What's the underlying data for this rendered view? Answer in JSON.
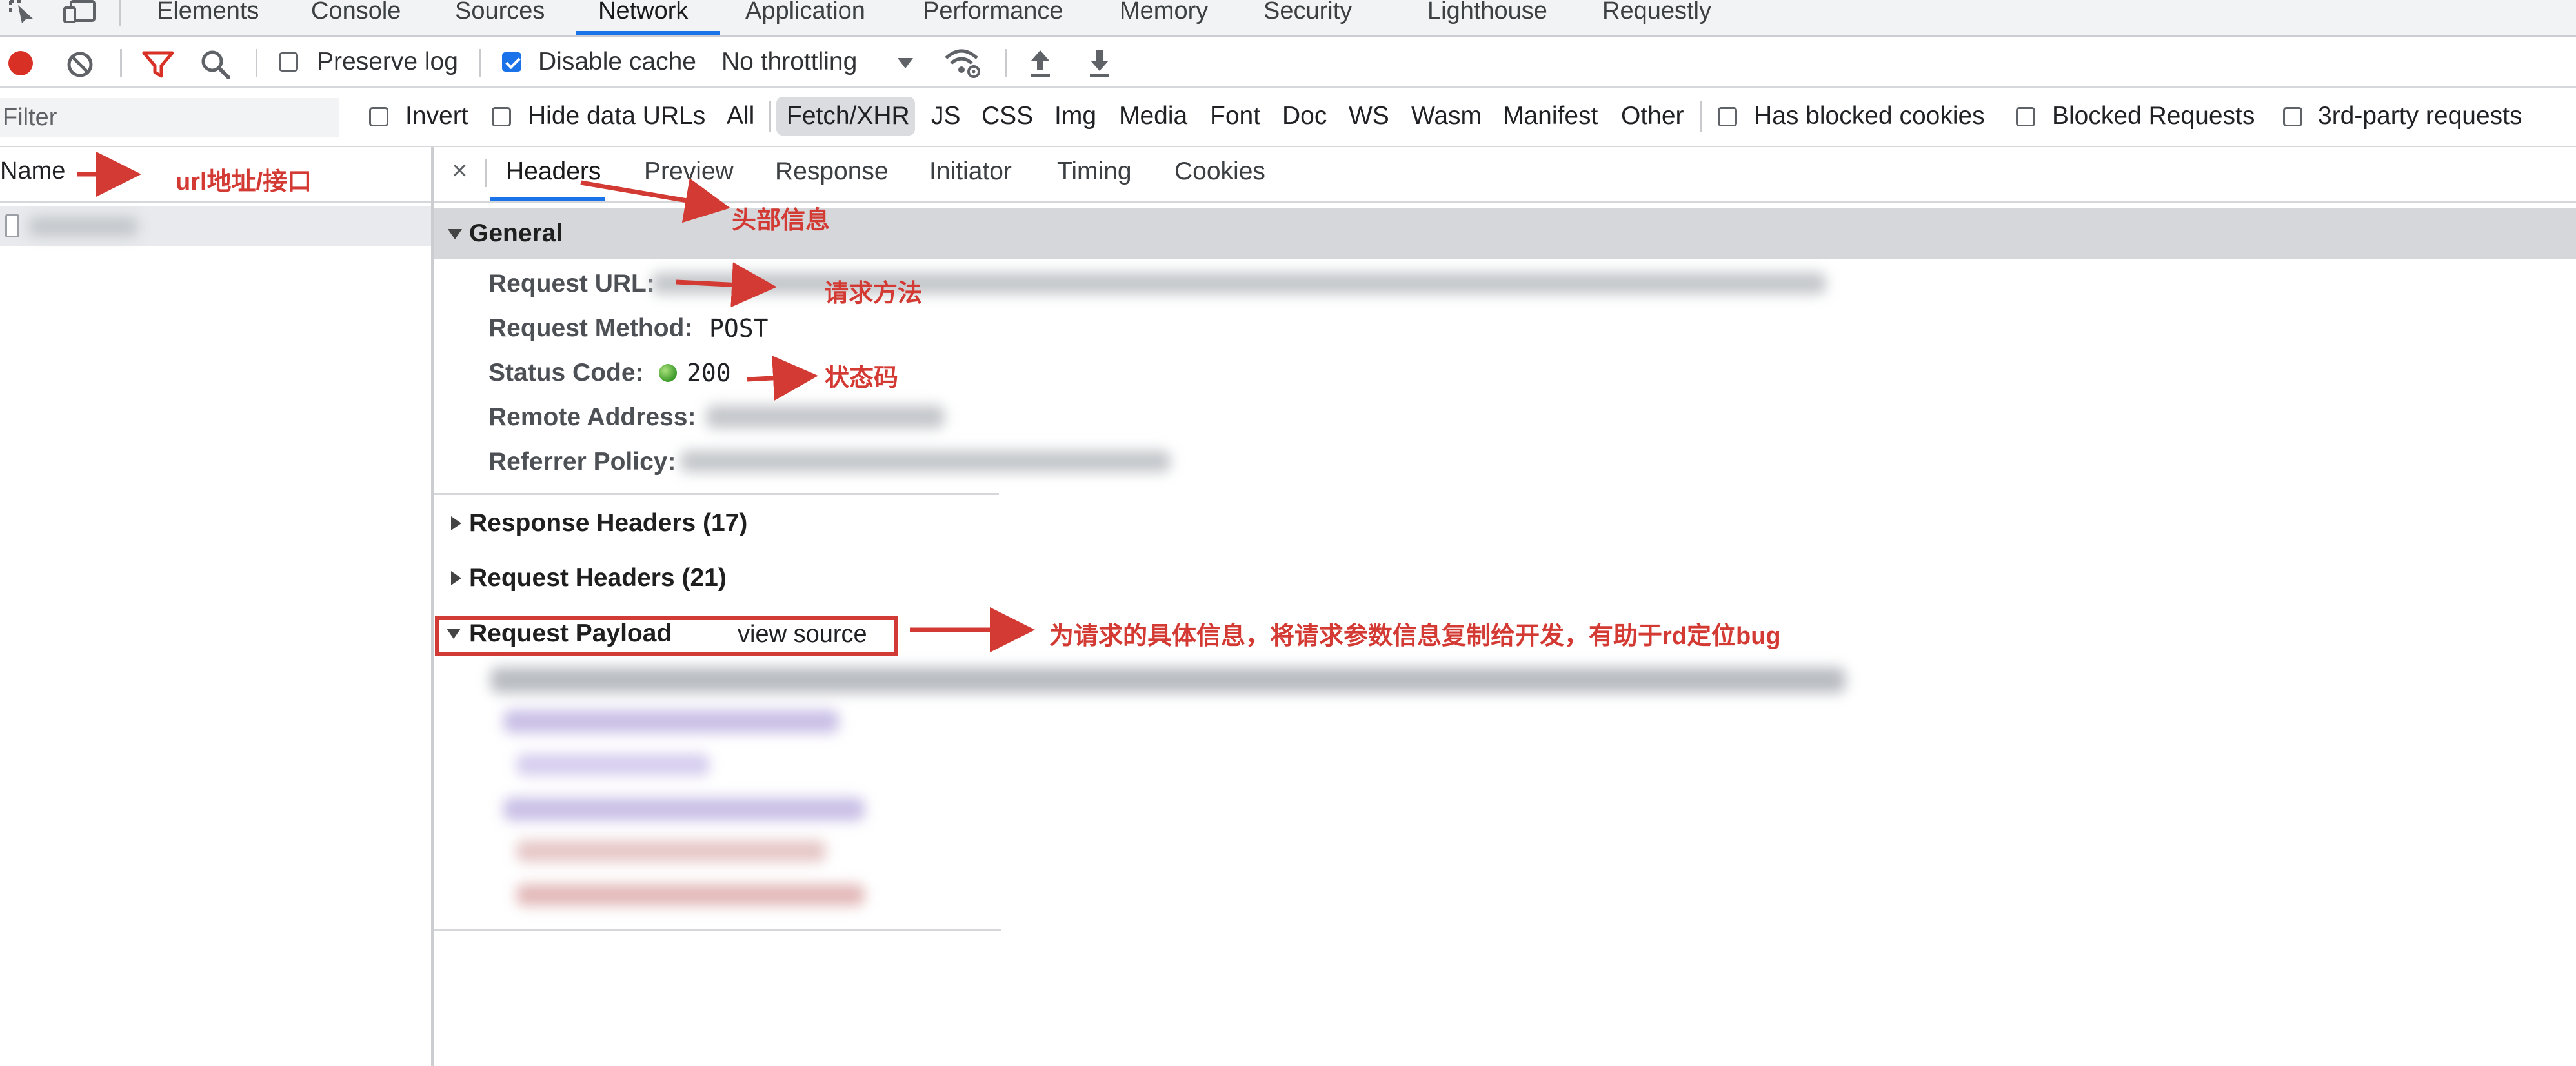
{
  "tabs": [
    {
      "label": "Elements"
    },
    {
      "label": "Console"
    },
    {
      "label": "Sources"
    },
    {
      "label": "Network"
    },
    {
      "label": "Application"
    },
    {
      "label": "Performance"
    },
    {
      "label": "Memory"
    },
    {
      "label": "Security"
    },
    {
      "label": "Lighthouse"
    },
    {
      "label": "Requestly"
    }
  ],
  "active_tab": "Network",
  "toolbar": {
    "preserve_log": {
      "label": "Preserve log",
      "checked": false
    },
    "disable_cache": {
      "label": "Disable cache",
      "checked": true
    },
    "throttling": "No throttling"
  },
  "filter": {
    "placeholder": "Filter",
    "invert": "Invert",
    "hide_data_urls": "Hide data URLs",
    "types": [
      "All",
      "Fetch/XHR",
      "JS",
      "CSS",
      "Img",
      "Media",
      "Font",
      "Doc",
      "WS",
      "Wasm",
      "Manifest",
      "Other"
    ],
    "active_type": "Fetch/XHR",
    "has_blocked_cookies": "Has blocked cookies",
    "blocked_requests": "Blocked Requests",
    "third_party": "3rd-party requests"
  },
  "request_list": {
    "header": "Name"
  },
  "detail": {
    "close": "×",
    "tabs": [
      "Headers",
      "Preview",
      "Response",
      "Initiator",
      "Timing",
      "Cookies"
    ],
    "active_tab": "Headers",
    "general": {
      "title": "General",
      "request_url_label": "Request URL:",
      "request_method_label": "Request Method:",
      "request_method": "POST",
      "status_code_label": "Status Code:",
      "status_code": "200",
      "remote_address_label": "Remote Address:",
      "referrer_policy_label": "Referrer Policy:"
    },
    "response_headers": "Response Headers (17)",
    "request_headers": "Request Headers (21)",
    "request_payload": "Request Payload",
    "view_source": "view source"
  },
  "annotations": {
    "url": "url地址/接口",
    "headers": "头部信息",
    "method": "请求方法",
    "status": "状态码",
    "payload": "为请求的具体信息，将请求参数信息复制给开发，有助于rd定位bug"
  },
  "colors": {
    "accent": "#1a73e8",
    "annotation": "#d33a33",
    "status_ok": "#3c9a2a"
  }
}
